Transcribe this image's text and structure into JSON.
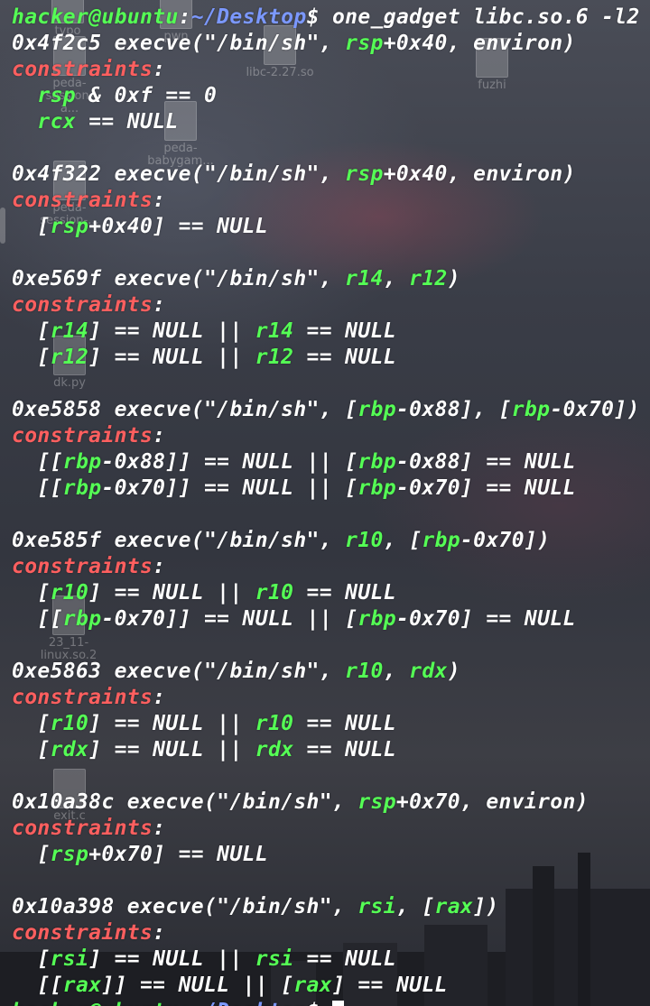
{
  "desktop": {
    "icons": [
      {
        "id": "typo",
        "label": "typo"
      },
      {
        "id": "pwn",
        "label": "pwn"
      },
      {
        "id": "libc227",
        "label": "libc-2.27.so"
      },
      {
        "id": "fuzhi",
        "label": "fuzhi"
      },
      {
        "id": "peda-session-a",
        "label": "peda-session-a..."
      },
      {
        "id": "peda-babygame",
        "label": "peda-babygam..."
      },
      {
        "id": "peda-session-b",
        "label": "peda-session-..."
      },
      {
        "id": "dk",
        "label": "dk.py"
      },
      {
        "id": "linux",
        "label": "23_11-linux.so.2"
      },
      {
        "id": "exit-c",
        "label": "exit.c"
      }
    ]
  },
  "terminal": {
    "prompt": {
      "user_host": "hacker@ubuntu",
      "colon": ":",
      "path": "~/Desktop",
      "dollar": "$",
      "command": " one_gadget libc.so.6 -l2"
    },
    "constraints_label": "constraints",
    "colon": ":",
    "gadgets": [
      {
        "addr": "0x4f2c5",
        "call_parts": [
          {
            "t": " execve(\"/bin/sh\", ",
            "c": "w"
          },
          {
            "t": "rsp",
            "c": "g"
          },
          {
            "t": "+0x40",
            "c": "w"
          },
          {
            "t": ", environ)",
            "c": "w"
          }
        ],
        "constraints": [
          [
            {
              "t": "  ",
              "c": "w"
            },
            {
              "t": "rsp",
              "c": "g"
            },
            {
              "t": " & 0xf == 0",
              "c": "w"
            }
          ],
          [
            {
              "t": "  ",
              "c": "w"
            },
            {
              "t": "rcx",
              "c": "g"
            },
            {
              "t": " == NULL",
              "c": "w"
            }
          ]
        ]
      },
      {
        "addr": "0x4f322",
        "call_parts": [
          {
            "t": " execve(\"/bin/sh\", ",
            "c": "w"
          },
          {
            "t": "rsp",
            "c": "g"
          },
          {
            "t": "+0x40",
            "c": "w"
          },
          {
            "t": ", environ)",
            "c": "w"
          }
        ],
        "constraints": [
          [
            {
              "t": "  [",
              "c": "w"
            },
            {
              "t": "rsp",
              "c": "g"
            },
            {
              "t": "+0x40] == NULL",
              "c": "w"
            }
          ]
        ]
      },
      {
        "addr": "0xe569f",
        "call_parts": [
          {
            "t": " execve(\"/bin/sh\", ",
            "c": "w"
          },
          {
            "t": "r14",
            "c": "g"
          },
          {
            "t": ", ",
            "c": "w"
          },
          {
            "t": "r12",
            "c": "g"
          },
          {
            "t": ")",
            "c": "w"
          }
        ],
        "constraints": [
          [
            {
              "t": "  [",
              "c": "w"
            },
            {
              "t": "r14",
              "c": "g"
            },
            {
              "t": "] == NULL || ",
              "c": "w"
            },
            {
              "t": "r14",
              "c": "g"
            },
            {
              "t": " == NULL",
              "c": "w"
            }
          ],
          [
            {
              "t": "  [",
              "c": "w"
            },
            {
              "t": "r12",
              "c": "g"
            },
            {
              "t": "] == NULL || ",
              "c": "w"
            },
            {
              "t": "r12",
              "c": "g"
            },
            {
              "t": " == NULL",
              "c": "w"
            }
          ]
        ]
      },
      {
        "addr": "0xe5858",
        "call_parts": [
          {
            "t": " execve(\"/bin/sh\", [",
            "c": "w"
          },
          {
            "t": "rbp",
            "c": "g"
          },
          {
            "t": "-0x88], [",
            "c": "w"
          },
          {
            "t": "rbp",
            "c": "g"
          },
          {
            "t": "-0x70])",
            "c": "w"
          }
        ],
        "constraints": [
          [
            {
              "t": "  [[",
              "c": "w"
            },
            {
              "t": "rbp",
              "c": "g"
            },
            {
              "t": "-0x88]] == NULL || [",
              "c": "w"
            },
            {
              "t": "rbp",
              "c": "g"
            },
            {
              "t": "-0x88] == NULL",
              "c": "w"
            }
          ],
          [
            {
              "t": "  [[",
              "c": "w"
            },
            {
              "t": "rbp",
              "c": "g"
            },
            {
              "t": "-0x70]] == NULL || [",
              "c": "w"
            },
            {
              "t": "rbp",
              "c": "g"
            },
            {
              "t": "-0x70] == NULL",
              "c": "w"
            }
          ]
        ]
      },
      {
        "addr": "0xe585f",
        "call_parts": [
          {
            "t": " execve(\"/bin/sh\", ",
            "c": "w"
          },
          {
            "t": "r10",
            "c": "g"
          },
          {
            "t": ", [",
            "c": "w"
          },
          {
            "t": "rbp",
            "c": "g"
          },
          {
            "t": "-0x70])",
            "c": "w"
          }
        ],
        "constraints": [
          [
            {
              "t": "  [",
              "c": "w"
            },
            {
              "t": "r10",
              "c": "g"
            },
            {
              "t": "] == NULL || ",
              "c": "w"
            },
            {
              "t": "r10",
              "c": "g"
            },
            {
              "t": " == NULL",
              "c": "w"
            }
          ],
          [
            {
              "t": "  [[",
              "c": "w"
            },
            {
              "t": "rbp",
              "c": "g"
            },
            {
              "t": "-0x70]] == NULL || [",
              "c": "w"
            },
            {
              "t": "rbp",
              "c": "g"
            },
            {
              "t": "-0x70] == NULL",
              "c": "w"
            }
          ]
        ]
      },
      {
        "addr": "0xe5863",
        "call_parts": [
          {
            "t": " execve(\"/bin/sh\", ",
            "c": "w"
          },
          {
            "t": "r10",
            "c": "g"
          },
          {
            "t": ", ",
            "c": "w"
          },
          {
            "t": "rdx",
            "c": "g"
          },
          {
            "t": ")",
            "c": "w"
          }
        ],
        "constraints": [
          [
            {
              "t": "  [",
              "c": "w"
            },
            {
              "t": "r10",
              "c": "g"
            },
            {
              "t": "] == NULL || ",
              "c": "w"
            },
            {
              "t": "r10",
              "c": "g"
            },
            {
              "t": " == NULL",
              "c": "w"
            }
          ],
          [
            {
              "t": "  [",
              "c": "w"
            },
            {
              "t": "rdx",
              "c": "g"
            },
            {
              "t": "] == NULL || ",
              "c": "w"
            },
            {
              "t": "rdx",
              "c": "g"
            },
            {
              "t": " == NULL",
              "c": "w"
            }
          ]
        ]
      },
      {
        "addr": "0x10a38c",
        "call_parts": [
          {
            "t": " execve(\"/bin/sh\", ",
            "c": "w"
          },
          {
            "t": "rsp",
            "c": "g"
          },
          {
            "t": "+0x70",
            "c": "w"
          },
          {
            "t": ", environ)",
            "c": "w"
          }
        ],
        "constraints": [
          [
            {
              "t": "  [",
              "c": "w"
            },
            {
              "t": "rsp",
              "c": "g"
            },
            {
              "t": "+0x70] == NULL",
              "c": "w"
            }
          ]
        ]
      },
      {
        "addr": "0x10a398",
        "call_parts": [
          {
            "t": " execve(\"/bin/sh\", ",
            "c": "w"
          },
          {
            "t": "rsi",
            "c": "g"
          },
          {
            "t": ", [",
            "c": "w"
          },
          {
            "t": "rax",
            "c": "g"
          },
          {
            "t": "])",
            "c": "w"
          }
        ],
        "constraints": [
          [
            {
              "t": "  [",
              "c": "w"
            },
            {
              "t": "rsi",
              "c": "g"
            },
            {
              "t": "] == NULL || ",
              "c": "w"
            },
            {
              "t": "rsi",
              "c": "g"
            },
            {
              "t": " == NULL",
              "c": "w"
            }
          ],
          [
            {
              "t": "  [[",
              "c": "w"
            },
            {
              "t": "rax",
              "c": "g"
            },
            {
              "t": "]] == NULL || [",
              "c": "w"
            },
            {
              "t": "rax",
              "c": "g"
            },
            {
              "t": "] == NULL",
              "c": "w"
            }
          ]
        ]
      }
    ],
    "final_prompt": {
      "user_host": "hacker@ubuntu",
      "colon": ":",
      "path": "~/Desktop",
      "dollar": "$ "
    }
  },
  "colors": {
    "prompt_user": "#55ff55",
    "prompt_path": "#7b98ff",
    "constraints": "#ff5f5f",
    "register": "#55ff55",
    "text": "#ffffff"
  }
}
